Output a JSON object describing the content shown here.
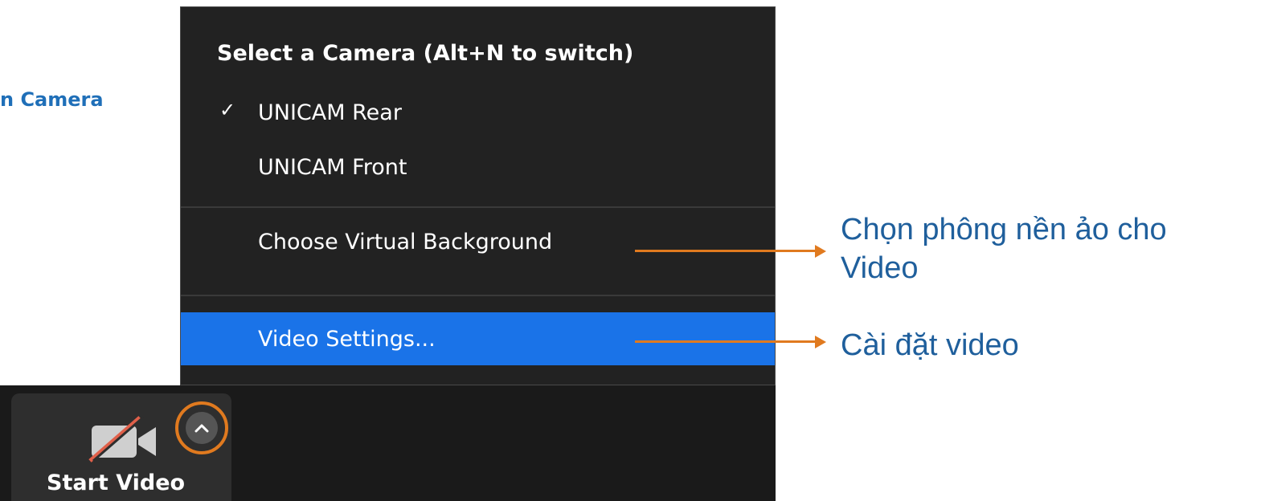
{
  "left_annotation": "n Camera",
  "menu": {
    "header": "Select a Camera (Alt+N to switch)",
    "items": [
      {
        "label": "UNICAM Rear",
        "checked": true
      },
      {
        "label": "UNICAM Front",
        "checked": false
      },
      {
        "label": "Choose Virtual Background",
        "checked": false
      },
      {
        "label": "Video Settings...",
        "checked": false,
        "highlighted": true
      }
    ],
    "check_glyph": "✓"
  },
  "toolbar": {
    "start_video_label": "Start Video",
    "camera_icon": "camera-off-icon",
    "chevron_icon": "chevron-up-icon"
  },
  "annotations": {
    "virtual_background": [
      "Chọn phông nền ảo cho",
      "Video"
    ],
    "video_settings": "Cài đặt video"
  },
  "colors": {
    "menu_bg": "#222222",
    "highlight": "#1a73e8",
    "annotation_orange": "#e07a1f",
    "annotation_blue": "#1f5f9c",
    "left_label_blue": "#1f6fb8"
  }
}
